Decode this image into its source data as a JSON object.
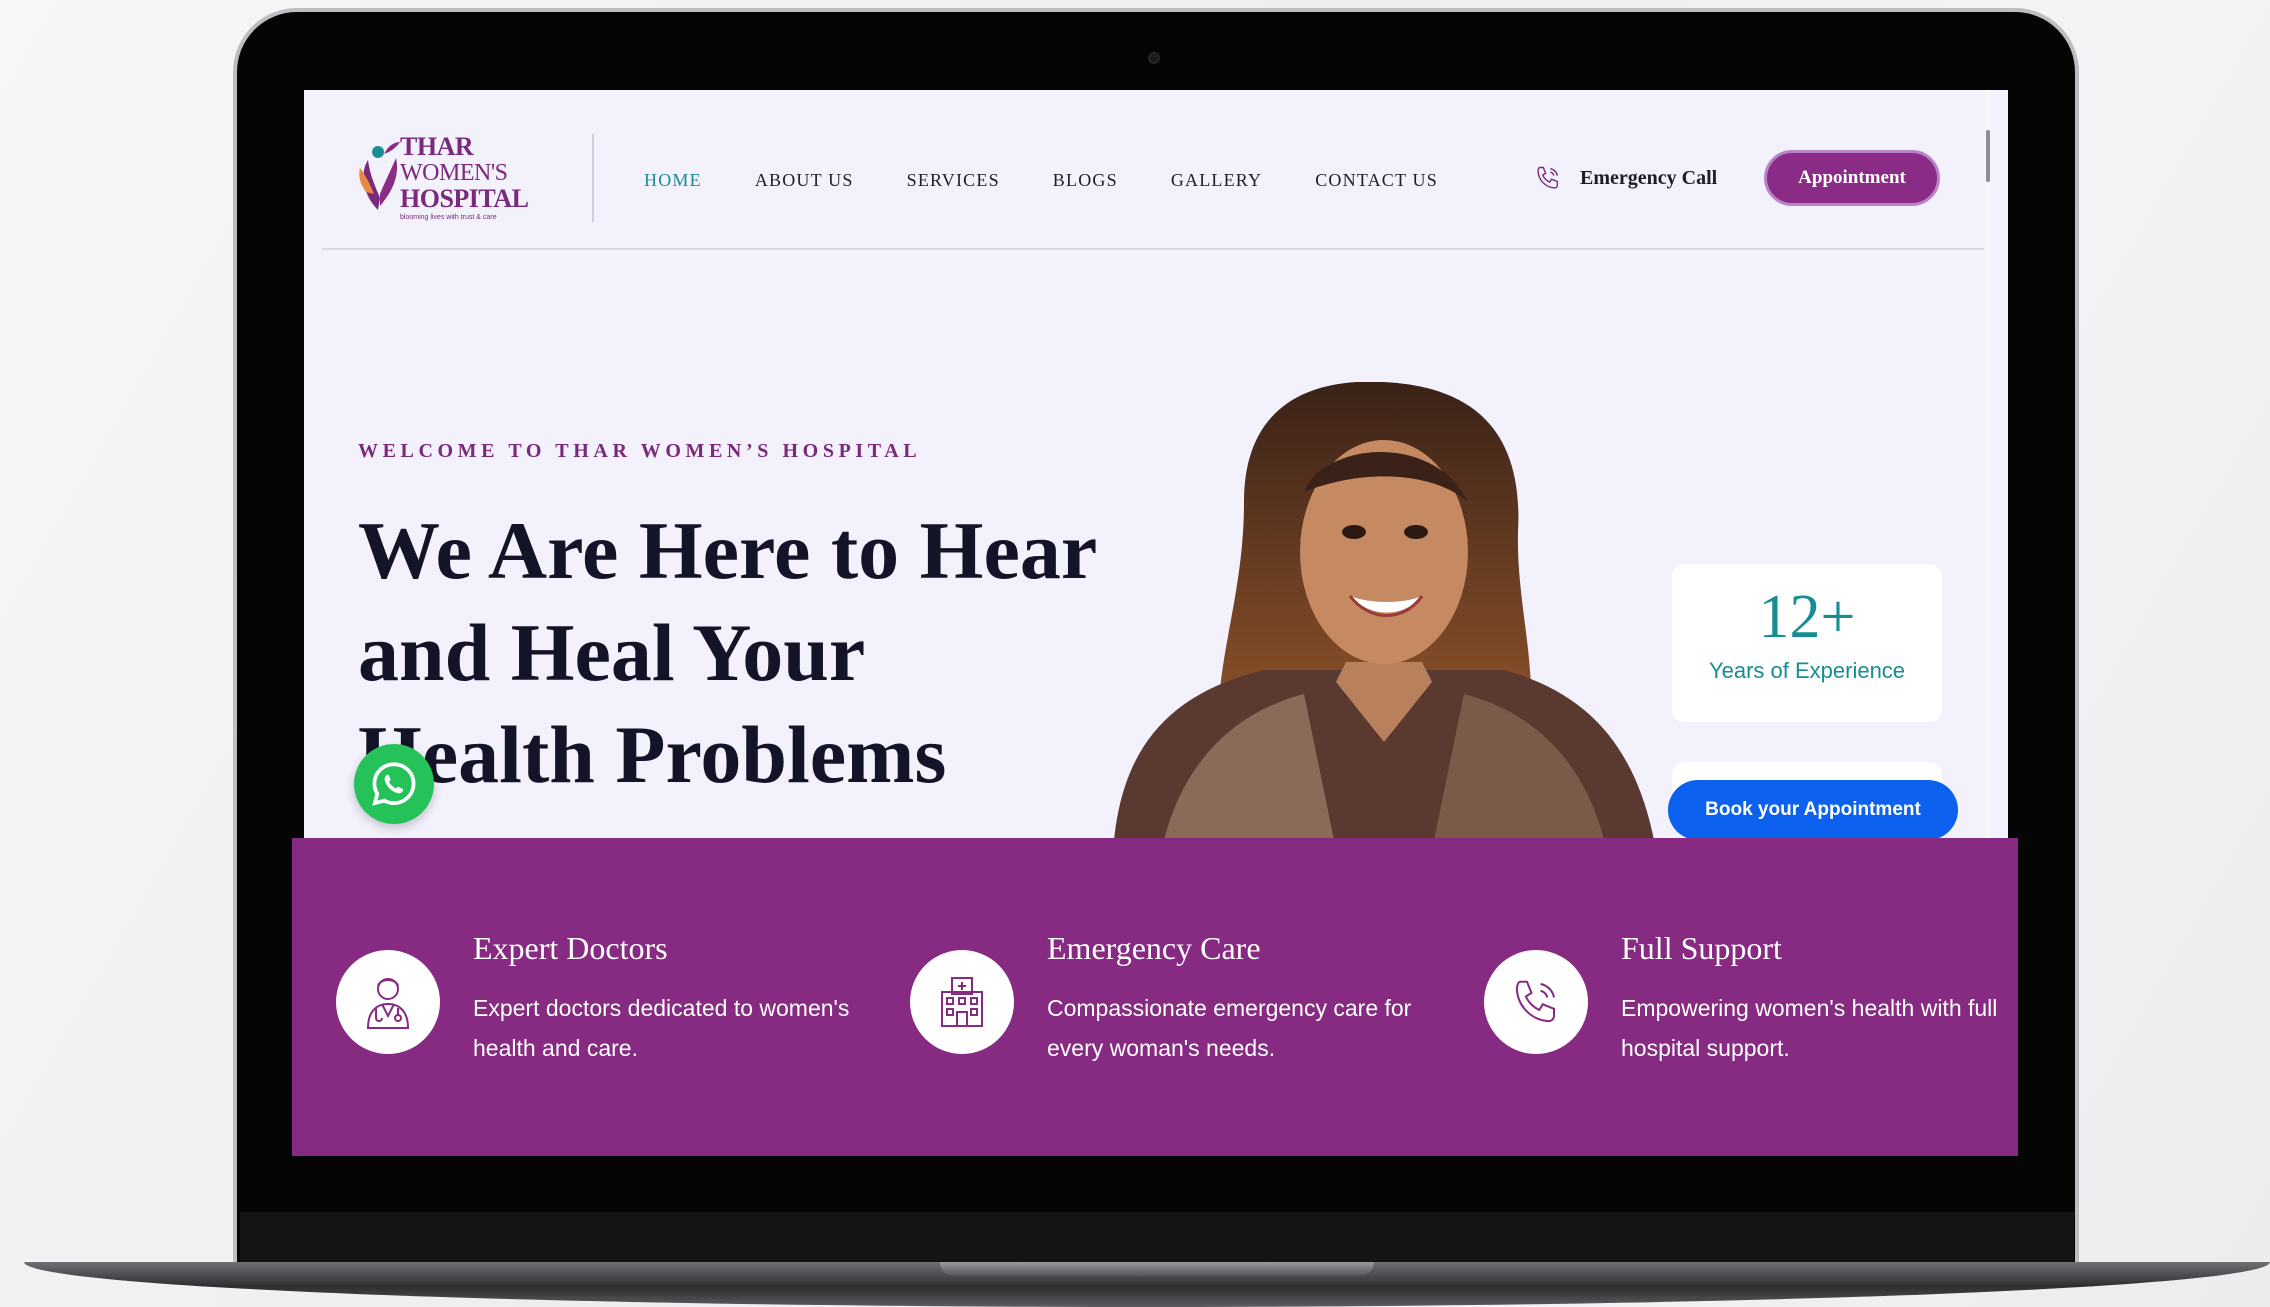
{
  "logo": {
    "line1": "THAR",
    "line2": "WOMEN'S",
    "line3": "HOSPITAL",
    "tagline": "blooming lives with trust & care"
  },
  "nav": {
    "items": [
      {
        "label": "HOME",
        "active": true
      },
      {
        "label": "ABOUT US",
        "active": false
      },
      {
        "label": "SERVICES",
        "active": false
      },
      {
        "label": "BLOGS",
        "active": false
      },
      {
        "label": "GALLERY",
        "active": false
      },
      {
        "label": "CONTACT US",
        "active": false
      }
    ]
  },
  "header": {
    "emergency_label": "Emergency Call",
    "appointment_label": "Appointment"
  },
  "hero": {
    "eyebrow": "WELCOME TO THAR WOMEN’S HOSPITAL",
    "title": "We Are Here to Hear and Heal Your Health Problems",
    "experience_value": "12+",
    "experience_label": "Years of Experience",
    "book_label": "Book your Appointment"
  },
  "features": [
    {
      "icon": "doctor-icon",
      "title": "Expert Doctors",
      "desc": "Expert doctors dedicated to women's health and care."
    },
    {
      "icon": "hospital-icon",
      "title": "Emergency Care",
      "desc": "Compassionate emergency care for every woman's needs."
    },
    {
      "icon": "phone-icon",
      "title": "Full Support",
      "desc": "Empowering women's health with full hospital support."
    }
  ],
  "colors": {
    "brand_purple": "#872a82",
    "teal": "#168d92",
    "book_blue": "#0c62ee",
    "whatsapp_green": "#25c25a",
    "hero_bg": "#f2f1fc"
  }
}
